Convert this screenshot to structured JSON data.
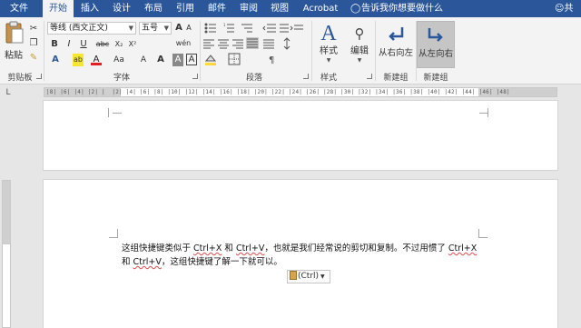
{
  "menu": {
    "tabs": [
      "文件",
      "开始",
      "插入",
      "设计",
      "布局",
      "引用",
      "邮件",
      "审阅",
      "视图",
      "Acrobat"
    ],
    "active_tab": "开始",
    "tell_me": "告诉我你想要做什么",
    "share": "共享"
  },
  "ribbon": {
    "clipboard": {
      "paste_label": "粘贴",
      "group_label": "剪贴板"
    },
    "font": {
      "font_name": "等线 (西文正文)",
      "font_size": "五号",
      "group_label": "字体",
      "buttons": [
        "B",
        "I",
        "U",
        "abc",
        "X₂",
        "X²",
        "A",
        "Aa",
        "A",
        "A",
        "A"
      ],
      "size_up": "A",
      "size_down": "A",
      "clear_format": "A",
      "phonetic": "wén",
      "char_border": "A"
    },
    "paragraph": {
      "group_label": "段落"
    },
    "styles": {
      "label": "样式",
      "group_label": "样式"
    },
    "editing": {
      "label": "编辑"
    },
    "new_group": [
      {
        "label": "从右向左",
        "active": false
      },
      {
        "label": "从左向右",
        "active": true
      }
    ],
    "new_group_labels": [
      "新建组",
      "新建组"
    ],
    "colors": {
      "accent": "#2b579a",
      "font_color": "#e02020",
      "highlight": "#f5e633"
    }
  },
  "ruler": {
    "corner_label": "L",
    "marks": "|8| |6| |4| |2| |  |2| |4| |6| |8| |10| |12| |14| |16| |18| |20| |22| |24| |26| |28| |30| |32| |34| |36| |38| |40| |42| |44| |46| |48|"
  },
  "document": {
    "paragraph": {
      "line1_a": "这组快捷键类似于 ",
      "k1": "Ctrl+X",
      "line1_b": " 和 ",
      "k2": "Ctrl+V",
      "line1_c": "，也就是我们经常说的剪切和复制。不过用惯了 ",
      "k3": "Ctrl+X",
      "line2_a": "和 ",
      "k4": "Ctrl+V",
      "line2_b": "，这组快捷键了解一下就可以。"
    },
    "paste_options": "(Ctrl)"
  }
}
